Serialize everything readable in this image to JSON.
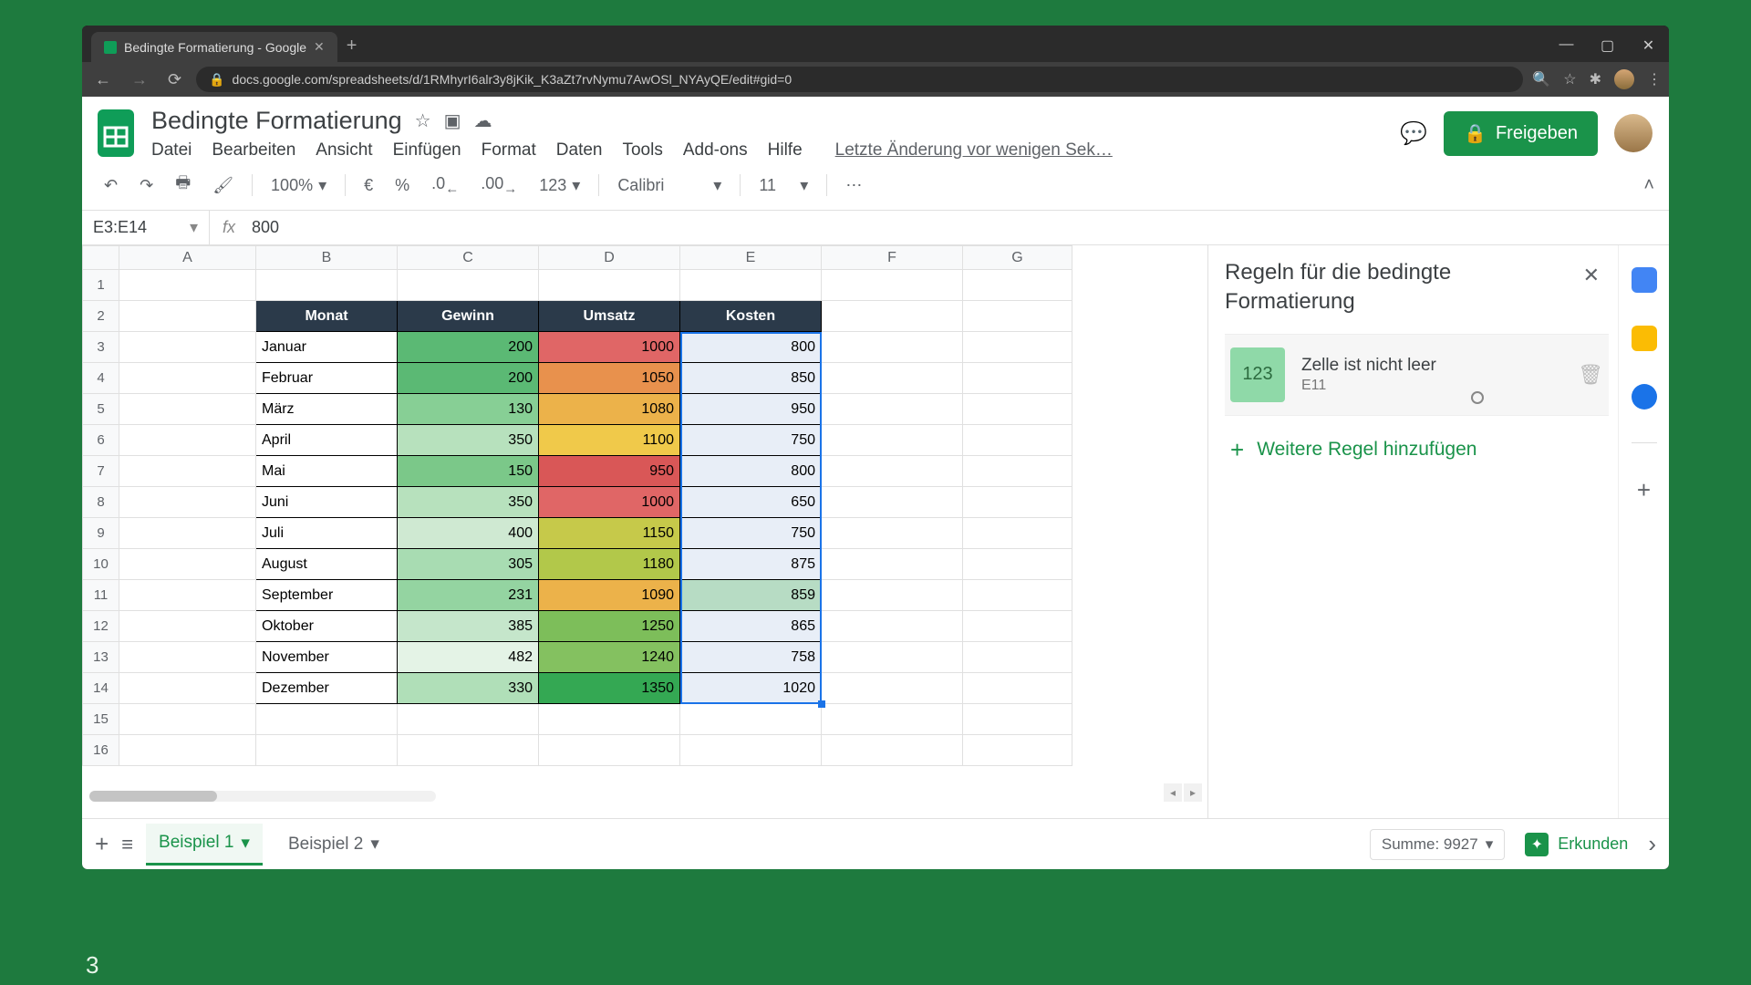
{
  "browser": {
    "tab_title": "Bedingte Formatierung - Google",
    "url": "docs.google.com/spreadsheets/d/1RMhyrI6alr3y8jKik_K3aZt7rvNymu7AwOSl_NYAyQE/edit#gid=0"
  },
  "app": {
    "doc_title": "Bedingte Formatierung",
    "menus": [
      "Datei",
      "Bearbeiten",
      "Ansicht",
      "Einfügen",
      "Format",
      "Daten",
      "Tools",
      "Add-ons",
      "Hilfe"
    ],
    "last_edit": "Letzte Änderung vor wenigen Sek…",
    "share_label": "Freigeben"
  },
  "toolbar": {
    "zoom": "100%",
    "currency": "€",
    "percent": "%",
    "dec_dec": ".0",
    "inc_dec": ".00",
    "num_format": "123",
    "font": "Calibri",
    "font_size": "11"
  },
  "namebox": {
    "ref": "E3:E14",
    "formula_value": "800"
  },
  "columns": [
    "A",
    "B",
    "C",
    "D",
    "E",
    "F",
    "G"
  ],
  "row_numbers": [
    1,
    2,
    3,
    4,
    5,
    6,
    7,
    8,
    9,
    10,
    11,
    12,
    13,
    14,
    15,
    16
  ],
  "table": {
    "headers": [
      "Monat",
      "Gewinn",
      "Umsatz",
      "Kosten"
    ],
    "rows": [
      {
        "b": "Januar",
        "c": 200,
        "d": 1000,
        "e": 800,
        "c_bg": "#5bb974",
        "d_bg": "#e06666"
      },
      {
        "b": "Februar",
        "c": 200,
        "d": 1050,
        "e": 850,
        "c_bg": "#5bb974",
        "d_bg": "#e8914d"
      },
      {
        "b": "März",
        "c": 130,
        "d": 1080,
        "e": 950,
        "c_bg": "#87cf95",
        "d_bg": "#ecb24a"
      },
      {
        "b": "April",
        "c": 350,
        "d": 1100,
        "e": 750,
        "c_bg": "#b7e1bd",
        "d_bg": "#f0c94a"
      },
      {
        "b": "Mai",
        "c": 150,
        "d": 950,
        "e": 800,
        "c_bg": "#7bc889",
        "d_bg": "#d95757"
      },
      {
        "b": "Juni",
        "c": 350,
        "d": 1000,
        "e": 650,
        "c_bg": "#b7e1bd",
        "d_bg": "#e06666"
      },
      {
        "b": "Juli",
        "c": 400,
        "d": 1150,
        "e": 750,
        "c_bg": "#cfe9d2",
        "d_bg": "#c6c94a"
      },
      {
        "b": "August",
        "c": 305,
        "d": 1180,
        "e": 875,
        "c_bg": "#a8dcb2",
        "d_bg": "#b2c84a"
      },
      {
        "b": "September",
        "c": 231,
        "d": 1090,
        "e": 859,
        "c_bg": "#94d4a1",
        "d_bg": "#ecb24a",
        "e_bg": "#b7dcc4"
      },
      {
        "b": "Oktober",
        "c": 385,
        "d": 1250,
        "e": 865,
        "c_bg": "#c5e6cb",
        "d_bg": "#7dbe5a"
      },
      {
        "b": "November",
        "c": 482,
        "d": 1240,
        "e": 758,
        "c_bg": "#e4f3e6",
        "d_bg": "#84c160"
      },
      {
        "b": "Dezember",
        "c": 330,
        "d": 1350,
        "e": 1020,
        "c_bg": "#b0dfb8",
        "d_bg": "#34a853"
      }
    ]
  },
  "side_panel": {
    "title": "Regeln für die bedingte Formatierung",
    "rule_swatch_text": "123",
    "rule_title": "Zelle ist nicht leer",
    "rule_range": "E11",
    "add_label": "Weitere Regel hinzufügen"
  },
  "footer": {
    "sheets": [
      "Beispiel 1",
      "Beispiel 2"
    ],
    "active_sheet_index": 0,
    "sum_label": "Summe: 9927",
    "explore_label": "Erkunden"
  },
  "page_number": "3"
}
